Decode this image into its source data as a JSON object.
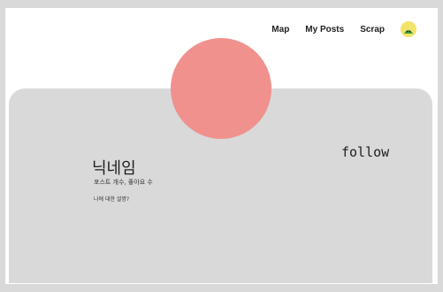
{
  "nav": {
    "items": [
      {
        "label": "Map"
      },
      {
        "label": "My Posts"
      },
      {
        "label": "Scrap"
      }
    ],
    "avatar_icon": "user-avatar-icon"
  },
  "profile": {
    "nickname": "닉네임",
    "stats": "포스트 개수, 좋아요 수",
    "bio": "나에 대한 설명?",
    "follow_label": "follow"
  },
  "colors": {
    "page_bg": "#d9d9d9",
    "card_bg": "#d9d9d9",
    "profile_pic": "#f0918e",
    "avatar_bg": "#f2e36b"
  }
}
